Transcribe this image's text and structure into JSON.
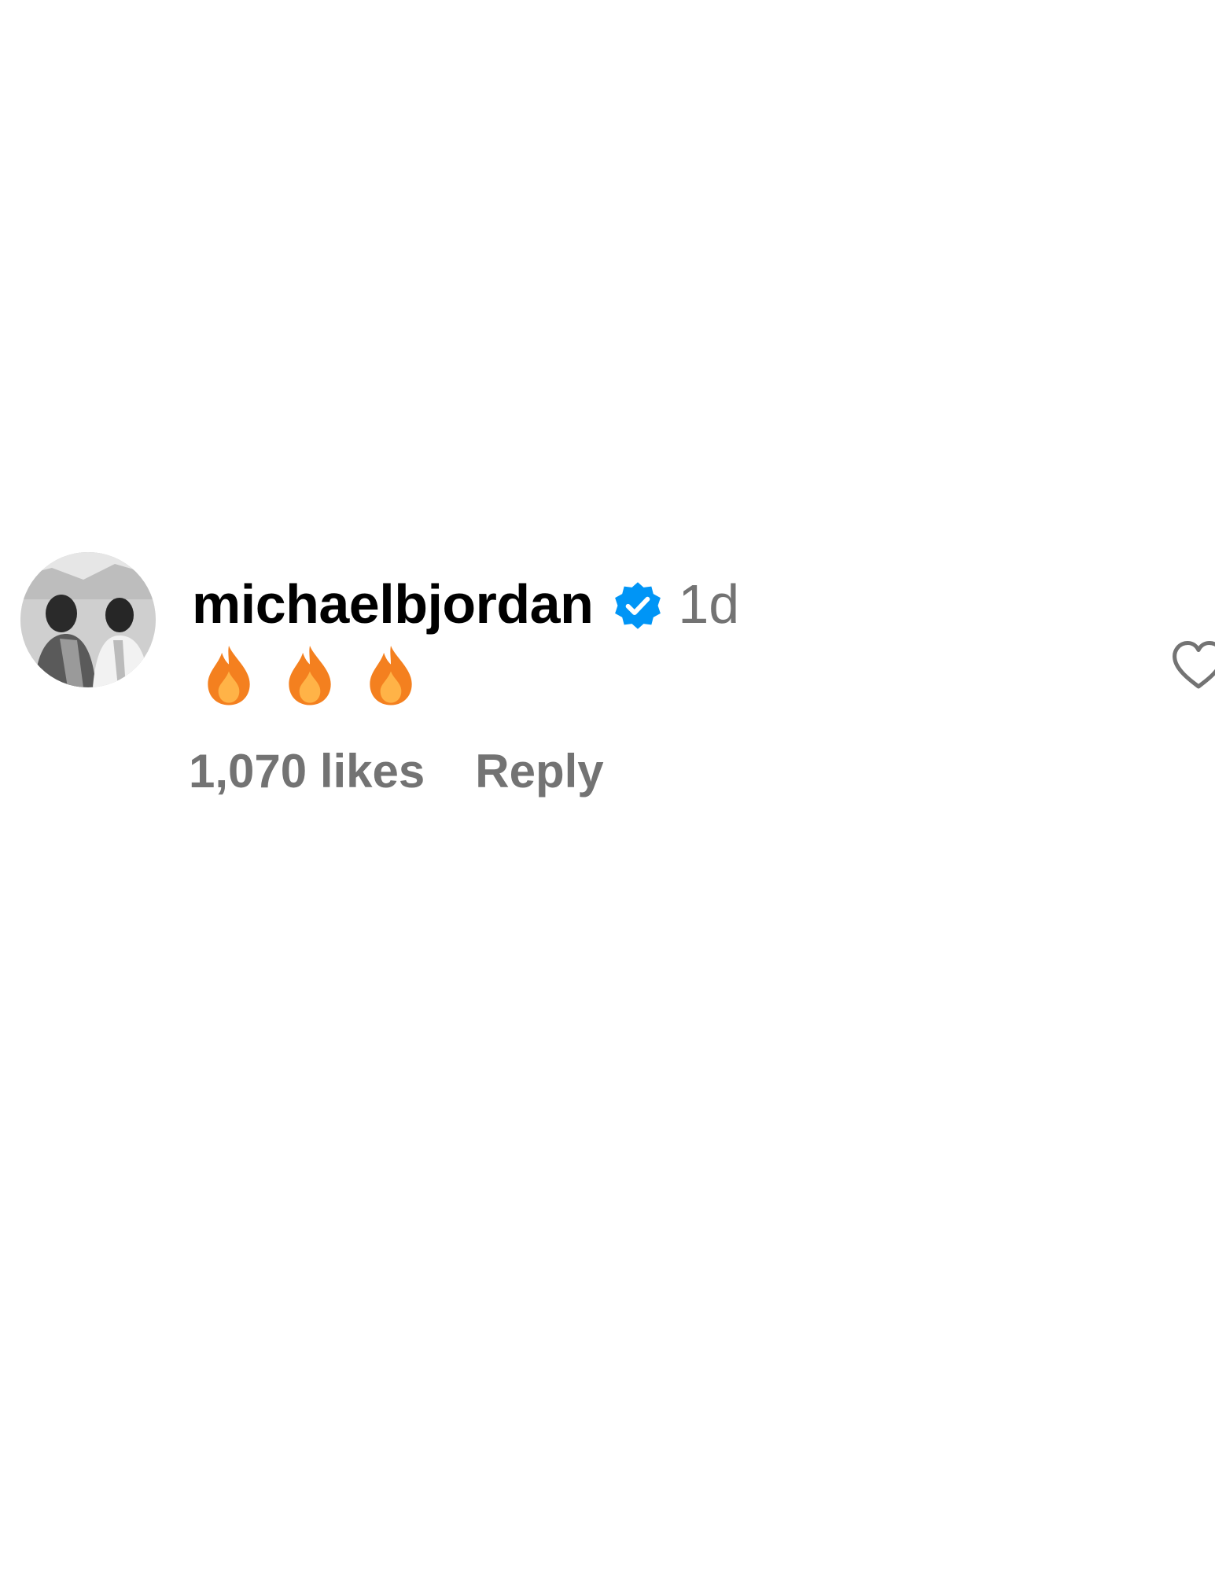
{
  "comment": {
    "avatar_icon": "profile-photo",
    "username": "michaelbjordan",
    "verified_icon": "verified-badge-icon",
    "timestamp": "1d",
    "text_emojis": [
      "fire-icon",
      "fire-icon",
      "fire-icon"
    ],
    "likes_label": "1,070 likes",
    "reply_label": "Reply",
    "like_icon": "heart-outline-icon"
  },
  "colors": {
    "username": "#000000",
    "secondary_text": "#737373",
    "verified_badge": "#0095f6",
    "fire_outer": "#f4801f",
    "fire_inner": "#ffb347"
  }
}
